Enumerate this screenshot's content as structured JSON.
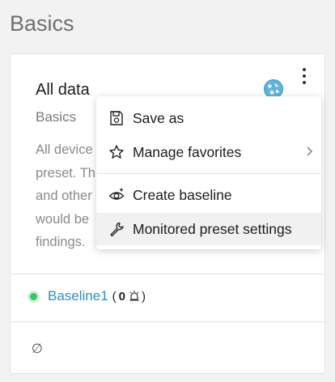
{
  "page": {
    "heading": "Basics"
  },
  "card": {
    "title": "All data",
    "subtitle": "Basics",
    "description_lines": [
      "All device",
      "preset. Th",
      "and other",
      "would be",
      "findings."
    ],
    "baseline": {
      "name": "Baseline1",
      "count_open": "(",
      "count": "0",
      "count_close": ")"
    },
    "empty_value": "∅"
  },
  "menu": {
    "items": [
      {
        "label": "Save as",
        "icon": "save-as-icon"
      },
      {
        "label": "Manage favorites",
        "icon": "star-icon",
        "has_submenu": true
      },
      {
        "label": "Create baseline",
        "icon": "eye-plus-icon"
      },
      {
        "label": "Monitored preset settings",
        "icon": "wrench-icon",
        "hovered": true
      }
    ]
  },
  "colors": {
    "link": "#2f8fc0",
    "status_green": "#3cc46a",
    "globe": "#5fb4d8"
  }
}
